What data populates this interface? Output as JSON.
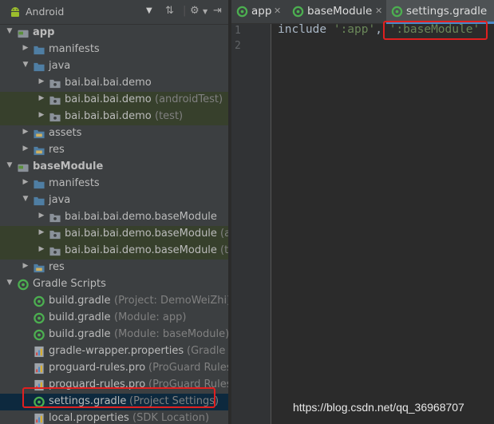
{
  "project_panel": {
    "view_selector": "Android",
    "tree": [
      {
        "level": 0,
        "icon": "module",
        "label": "app",
        "bold": true,
        "caret": "down"
      },
      {
        "level": 1,
        "icon": "folder",
        "label": "manifests",
        "caret": "right"
      },
      {
        "level": 1,
        "icon": "folder",
        "label": "java",
        "caret": "down"
      },
      {
        "level": 2,
        "icon": "package",
        "label": "bai.bai.bai.demo",
        "caret": "right"
      },
      {
        "level": 2,
        "icon": "package",
        "label": "bai.bai.bai.demo",
        "sub": "(androidTest)",
        "caret": "right",
        "hl": true
      },
      {
        "level": 2,
        "icon": "package",
        "label": "bai.bai.bai.demo",
        "sub": "(test)",
        "caret": "right",
        "hl": true
      },
      {
        "level": 1,
        "icon": "folder-res",
        "label": "assets",
        "caret": "right"
      },
      {
        "level": 1,
        "icon": "folder-res",
        "label": "res",
        "caret": "right"
      },
      {
        "level": 0,
        "icon": "module",
        "label": "baseModule",
        "bold": true,
        "caret": "down"
      },
      {
        "level": 1,
        "icon": "folder",
        "label": "manifests",
        "caret": "right"
      },
      {
        "level": 1,
        "icon": "folder",
        "label": "java",
        "caret": "down"
      },
      {
        "level": 2,
        "icon": "package",
        "label": "bai.bai.bai.demo.baseModule",
        "caret": "right"
      },
      {
        "level": 2,
        "icon": "package",
        "label": "bai.bai.bai.demo.baseModule",
        "sub": "(and",
        "caret": "right",
        "hl": true
      },
      {
        "level": 2,
        "icon": "package",
        "label": "bai.bai.bai.demo.baseModule",
        "sub": "(test",
        "caret": "right",
        "hl": true
      },
      {
        "level": 1,
        "icon": "folder-res",
        "label": "res",
        "caret": "right"
      },
      {
        "level": 0,
        "icon": "gradle",
        "label": "Gradle Scripts",
        "caret": "down"
      },
      {
        "level": 1,
        "icon": "gradle",
        "label": "build.gradle",
        "sub": "(Project: DemoWeiZhi)"
      },
      {
        "level": 1,
        "icon": "gradle",
        "label": "build.gradle",
        "sub": "(Module: app)"
      },
      {
        "level": 1,
        "icon": "gradle",
        "label": "build.gradle",
        "sub": "(Module: baseModule)"
      },
      {
        "level": 1,
        "icon": "props",
        "label": "gradle-wrapper.properties",
        "sub": "(Gradle Ve"
      },
      {
        "level": 1,
        "icon": "props",
        "label": "proguard-rules.pro",
        "sub": "(ProGuard Rules fo"
      },
      {
        "level": 1,
        "icon": "props",
        "label": "proguard-rules.pro",
        "sub": "(ProGuard Rules fo"
      },
      {
        "level": 1,
        "icon": "gradle",
        "label": "settings.gradle",
        "sub": "(Project Settings)",
        "selected": true
      },
      {
        "level": 1,
        "icon": "props",
        "label": "local.properties",
        "sub": "(SDK Location)"
      }
    ]
  },
  "editor": {
    "tabs": [
      {
        "label": "app",
        "active": false
      },
      {
        "label": "baseModule",
        "active": false
      },
      {
        "label": "settings.gradle",
        "active": true
      }
    ],
    "line_numbers": [
      "1",
      "2"
    ],
    "code": {
      "keyword": "include",
      "str1": "':app'",
      "comma": ",",
      "str2": "':baseModule'"
    }
  },
  "watermark": "https://blog.csdn.net/qq_36968707",
  "colors": {
    "panel_bg": "#3c3f41",
    "editor_bg": "#2b2b2b",
    "selection": "#0d293e",
    "highlight": "#37402c",
    "annotation_red": "#e02020",
    "string_green": "#6a8759",
    "text": "#bbbbbb"
  }
}
